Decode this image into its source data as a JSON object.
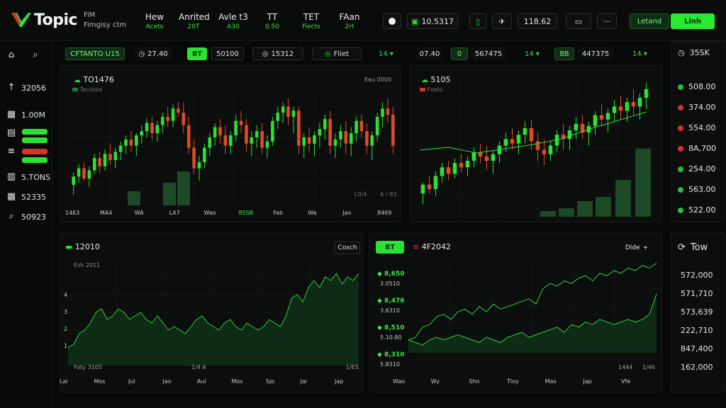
{
  "brand": {
    "name": "Topic",
    "sub_line1": "FiM",
    "sub_line2": "Fimgisy ctm"
  },
  "nav": [
    {
      "label": "Hew",
      "sub": "Acets"
    },
    {
      "label": "Anrited",
      "sub": "20T"
    },
    {
      "label": "Avle t3",
      "sub": "A30"
    },
    {
      "label": "TT",
      "sub": "0.50"
    },
    {
      "label": "TET",
      "sub": "Fiects"
    },
    {
      "label": "FAan",
      "sub": "2rt"
    }
  ],
  "toolbar": {
    "record_icon": "circle-icon",
    "value1": "10.5317",
    "value2": "118.62",
    "more": "···",
    "btn_dark": "Letand",
    "btn_green": "Linh"
  },
  "rail": [
    {
      "icon": "home-icon",
      "glyph": "⌂",
      "label": ""
    },
    {
      "icon": "arrow-up-icon",
      "glyph": "↑",
      "label": "32056"
    },
    {
      "icon": "grid-icon",
      "glyph": "▦",
      "label": "1.00M"
    },
    {
      "icon": "chart-icon",
      "glyph": "▤",
      "label": ""
    },
    {
      "icon": "list-icon",
      "glyph": "≡",
      "label": ""
    },
    {
      "icon": "bars-icon",
      "glyph": "▥",
      "label": "5.TONS"
    },
    {
      "icon": "calc-icon",
      "glyph": "▦",
      "label": "52335"
    },
    {
      "icon": "search-icon",
      "glyph": "⌕",
      "label": "50923"
    }
  ],
  "top_strip": {
    "tag": "CFTANTO U15",
    "v1": "27.40",
    "green": "8T",
    "v2": "50100",
    "v3": "15312",
    "v4": "Fliet",
    "v5": "14 ▾",
    "v6": "07.40",
    "v7": "0",
    "v8": "567475",
    "v9": "14 ▾",
    "v10": "8B",
    "v11": "447375",
    "v12": "14 ▾",
    "v13": "35SK"
  },
  "chart1": {
    "title": "TO1476",
    "legend": "Tecsbee",
    "corner": "Eau  0000",
    "mini1": "L0/4",
    "mini2": "A / 83",
    "x_labels": [
      "1463",
      "MA4",
      "WA",
      "LA7",
      "Wao",
      "8SSB",
      "Fab",
      "Wa",
      "Jao",
      "8469"
    ],
    "green_idx": 5,
    "chart_data": {
      "type": "candlestick",
      "ohlc": [
        [
          120,
          132,
          110,
          128
        ],
        [
          128,
          140,
          122,
          136
        ],
        [
          136,
          142,
          124,
          126
        ],
        [
          126,
          138,
          118,
          134
        ],
        [
          134,
          150,
          130,
          146
        ],
        [
          146,
          152,
          132,
          138
        ],
        [
          138,
          154,
          134,
          150
        ],
        [
          150,
          160,
          140,
          144
        ],
        [
          144,
          156,
          136,
          152
        ],
        [
          152,
          162,
          144,
          158
        ],
        [
          158,
          168,
          150,
          164
        ],
        [
          164,
          172,
          152,
          158
        ],
        [
          158,
          170,
          148,
          168
        ],
        [
          168,
          178,
          160,
          172
        ],
        [
          172,
          184,
          166,
          180
        ],
        [
          180,
          186,
          164,
          170
        ],
        [
          170,
          182,
          162,
          178
        ],
        [
          178,
          190,
          170,
          186
        ],
        [
          186,
          196,
          176,
          182
        ],
        [
          182,
          198,
          176,
          194
        ],
        [
          194,
          200,
          186,
          190
        ],
        [
          190,
          200,
          170,
          178
        ],
        [
          178,
          186,
          150,
          156
        ],
        [
          156,
          164,
          130,
          136
        ],
        [
          136,
          148,
          124,
          142
        ],
        [
          142,
          160,
          136,
          156
        ],
        [
          156,
          170,
          148,
          166
        ],
        [
          166,
          180,
          158,
          176
        ],
        [
          176,
          184,
          160,
          168
        ],
        [
          168,
          178,
          150,
          158
        ],
        [
          158,
          172,
          150,
          168
        ],
        [
          168,
          188,
          162,
          182
        ],
        [
          182,
          192,
          170,
          178
        ],
        [
          178,
          184,
          152,
          160
        ],
        [
          160,
          172,
          148,
          166
        ],
        [
          166,
          178,
          156,
          172
        ],
        [
          172,
          180,
          150,
          156
        ],
        [
          156,
          168,
          146,
          162
        ],
        [
          162,
          186,
          158,
          182
        ],
        [
          182,
          196,
          174,
          190
        ],
        [
          190,
          200,
          180,
          196
        ],
        [
          196,
          204,
          178,
          186
        ],
        [
          186,
          196,
          170,
          192
        ],
        [
          192,
          196,
          150,
          158
        ],
        [
          158,
          170,
          146,
          166
        ],
        [
          166,
          176,
          152,
          160
        ],
        [
          160,
          172,
          148,
          168
        ],
        [
          168,
          180,
          156,
          174
        ],
        [
          174,
          188,
          164,
          184
        ],
        [
          184,
          192,
          150,
          158
        ],
        [
          158,
          170,
          146,
          164
        ],
        [
          164,
          178,
          156,
          172
        ],
        [
          172,
          182,
          150,
          160
        ],
        [
          160,
          176,
          148,
          170
        ],
        [
          170,
          186,
          162,
          182
        ],
        [
          182,
          188,
          166,
          172
        ],
        [
          172,
          180,
          150,
          158
        ],
        [
          158,
          172,
          144,
          168
        ],
        [
          168,
          190,
          162,
          186
        ],
        [
          186,
          200,
          176,
          194
        ],
        [
          194,
          204,
          180,
          188
        ],
        [
          188,
          196,
          150,
          158
        ]
      ],
      "volume": [
        0,
        0,
        0,
        0,
        0,
        0,
        0,
        0,
        0,
        0,
        0,
        0,
        0,
        0,
        0,
        0,
        0,
        0,
        0,
        0,
        0,
        0,
        0,
        0,
        0,
        0,
        0,
        0,
        0,
        0,
        0,
        0,
        0,
        0,
        0,
        0,
        0,
        0,
        0,
        0,
        0,
        0,
        0,
        0,
        0,
        0,
        0,
        0,
        0,
        0,
        0,
        0,
        0,
        0,
        0,
        0,
        0,
        0,
        0,
        0,
        0,
        0
      ]
    }
  },
  "chart2": {
    "title": "5105",
    "legend": "Foeto",
    "chart_data": {
      "type": "candlestick",
      "ohlc": [
        [
          110,
          120,
          100,
          118
        ],
        [
          118,
          126,
          110,
          114
        ],
        [
          114,
          130,
          108,
          126
        ],
        [
          126,
          138,
          120,
          134
        ],
        [
          134,
          140,
          122,
          128
        ],
        [
          128,
          142,
          124,
          138
        ],
        [
          138,
          146,
          130,
          134
        ],
        [
          134,
          144,
          126,
          140
        ],
        [
          140,
          152,
          134,
          148
        ],
        [
          148,
          156,
          138,
          144
        ],
        [
          144,
          154,
          132,
          140
        ],
        [
          140,
          150,
          128,
          146
        ],
        [
          146,
          158,
          138,
          154
        ],
        [
          154,
          166,
          148,
          160
        ],
        [
          160,
          170,
          150,
          156
        ],
        [
          156,
          168,
          146,
          164
        ],
        [
          164,
          176,
          156,
          170
        ],
        [
          170,
          178,
          150,
          158
        ],
        [
          158,
          166,
          140,
          150
        ],
        [
          150,
          160,
          136,
          146
        ],
        [
          146,
          158,
          140,
          154
        ],
        [
          154,
          168,
          148,
          164
        ],
        [
          164,
          174,
          150,
          160
        ],
        [
          160,
          172,
          150,
          168
        ],
        [
          168,
          180,
          160,
          174
        ],
        [
          174,
          182,
          160,
          166
        ],
        [
          166,
          176,
          154,
          172
        ],
        [
          172,
          186,
          164,
          182
        ],
        [
          182,
          192,
          172,
          178
        ],
        [
          178,
          188,
          166,
          184
        ],
        [
          184,
          196,
          176,
          190
        ],
        [
          190,
          200,
          178,
          186
        ],
        [
          186,
          198,
          176,
          194
        ],
        [
          194,
          206,
          182,
          190
        ],
        [
          190,
          202,
          178,
          198
        ],
        [
          198,
          212,
          188,
          206
        ]
      ],
      "volume": [
        0,
        0,
        0,
        0,
        0,
        0,
        0,
        0,
        0,
        0,
        0,
        0,
        0,
        0,
        0,
        0,
        0,
        0,
        0,
        0,
        0,
        0,
        0,
        0,
        0,
        0,
        0,
        0,
        0,
        0,
        0,
        0,
        0,
        0,
        0,
        0
      ],
      "trend_line": true
    }
  },
  "watchlist": [
    {
      "value": "508.00",
      "color": "#2fb84a"
    },
    {
      "value": "374.00",
      "color": "#d6322a"
    },
    {
      "value": "554.00",
      "color": "#d6322a"
    },
    {
      "value": "8A,700",
      "color": "#d6322a"
    },
    {
      "value": "254.00",
      "color": "#2fb84a"
    },
    {
      "value": "563.00",
      "color": "#2fb84a"
    },
    {
      "value": "522.00",
      "color": "#2fb84a"
    }
  ],
  "chart3": {
    "title": "12010",
    "btn": "Cosch",
    "legend": "Esh 2011",
    "y_labels": [
      "4",
      "3",
      "2",
      "1"
    ],
    "mini1": "Foty 3105",
    "mini2": "1/4 A",
    "mini3": "1/ES",
    "x_labels": [
      "Lai",
      "Mos",
      "Jul",
      "Jao",
      "Aul",
      "Mos",
      "Sjo",
      "Jal",
      "Jap"
    ],
    "chart_data": {
      "type": "area",
      "values": [
        0.5,
        0.6,
        0.9,
        1.0,
        1.2,
        1.5,
        1.6,
        1.3,
        1.4,
        1.6,
        1.5,
        1.3,
        1.4,
        1.5,
        1.3,
        1.2,
        1.4,
        1.2,
        1.0,
        1.1,
        1.0,
        0.9,
        1.1,
        1.3,
        1.4,
        1.2,
        1.1,
        1.0,
        1.2,
        1.3,
        1.1,
        1.0,
        1.2,
        1.1,
        1.0,
        1.1,
        1.3,
        1.2,
        1.1,
        1.4,
        1.9,
        2.0,
        1.8,
        2.2,
        2.4,
        2.2,
        2.5,
        2.4,
        2.6,
        2.3,
        2.5,
        2.4,
        2.6
      ]
    }
  },
  "chart4": {
    "tag": "8T",
    "title": "4F2042",
    "btn": "Dlde",
    "left_labels": [
      {
        "v": "8,650",
        "s": "3.0510"
      },
      {
        "v": "8,476",
        "s": "3.6310"
      },
      {
        "v": "8,510",
        "s": "5.10.80"
      },
      {
        "v": "8,310",
        "s": "5.8310"
      }
    ],
    "mini1": "1444",
    "mini2": "1/46",
    "x_labels": [
      "Wao",
      "Wy",
      "Sho",
      "Tloy",
      "Mas",
      "Jap",
      "Vfe"
    ],
    "chart_data": {
      "type": "line",
      "series": [
        {
          "values": [
            60,
            62,
            70,
            72,
            78,
            80,
            76,
            82,
            84,
            80,
            86,
            82,
            88,
            84,
            86,
            88,
            90,
            92,
            88,
            100,
            104,
            102,
            106,
            104,
            108,
            110,
            106,
            112,
            110,
            114,
            112,
            116,
            114,
            118,
            116,
            120
          ]
        },
        {
          "values": [
            60,
            58,
            56,
            60,
            62,
            60,
            62,
            64,
            62,
            60,
            58,
            62,
            60,
            58,
            62,
            64,
            66,
            62,
            64,
            66,
            68,
            70,
            66,
            72,
            70,
            74,
            72,
            76,
            74,
            72,
            74,
            76,
            74,
            76,
            80,
            96
          ]
        }
      ]
    }
  },
  "right_panel": {
    "title": "Tow",
    "values": [
      "572,000",
      "571,710",
      "573,639",
      "222,710",
      "847,400",
      "162,000"
    ]
  }
}
